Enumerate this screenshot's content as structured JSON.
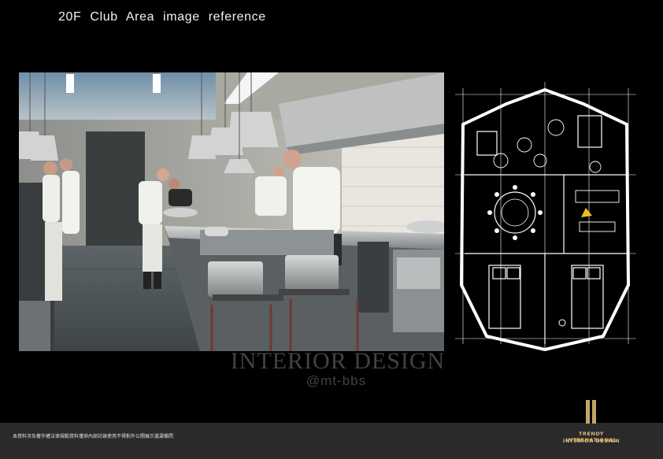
{
  "header": {
    "title": "20F Club  Area  image  reference"
  },
  "watermark": {
    "line1": "INTERIOR DESIGN",
    "line2": "@mt-bbs"
  },
  "footer": {
    "disclaimer": "本資料涉及著作權法律規範資料僅供內部討論使用不得對外公開展示遺漏備問"
  },
  "logo": {
    "line1": "TRENDY INTERNATIONAL",
    "line2": "INTERIOR DESIGN"
  },
  "images": {
    "photo": {
      "subject": "commercial-kitchen-photo"
    },
    "plan": {
      "subject": "floor-plan-drawing"
    }
  },
  "colors": {
    "background": "#000000",
    "footer": "#2a2a2a",
    "logo_gold": "#c4a46a"
  }
}
